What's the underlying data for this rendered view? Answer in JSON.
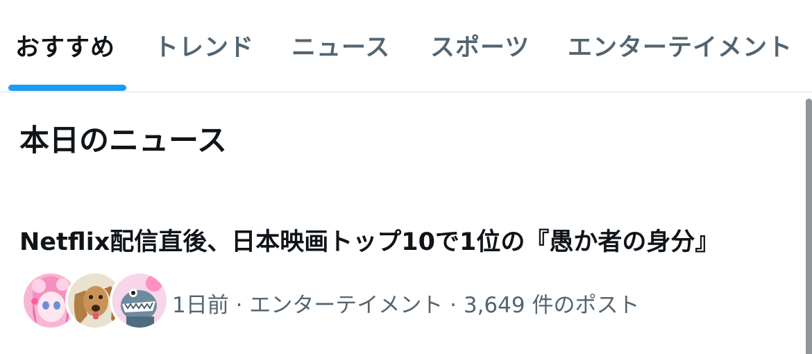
{
  "tabs": [
    {
      "label": "おすすめ",
      "active": true
    },
    {
      "label": "トレンド",
      "active": false
    },
    {
      "label": "ニュース",
      "active": false
    },
    {
      "label": "スポーツ",
      "active": false
    },
    {
      "label": "エンターテイメント",
      "active": false
    }
  ],
  "section": {
    "title": "本日のニュース"
  },
  "news": {
    "headline": "Netflix配信直後、日本映画トップ10で1位の『愚か者の身分』",
    "meta": "1日前 · エンターテイメント · 3,649 件のポスト",
    "avatars": [
      "anime-girl-avatar",
      "dog-avatar",
      "cartoon-creature-avatar"
    ]
  },
  "colors": {
    "accent": "#1d9bf0",
    "secondary_text": "#536471",
    "primary_text": "#0f1419"
  }
}
